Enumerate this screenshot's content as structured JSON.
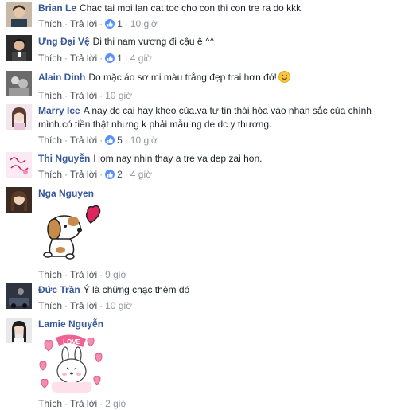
{
  "comments": [
    {
      "author": "Brian Le",
      "text": "Chac tai moi lan cat toc cho con thi con tre ra do kkk",
      "reply": "Thích",
      "reply2": "Trả lời",
      "likes": "1",
      "time": "10 giờ"
    },
    {
      "author": "Ưng Đại Vệ",
      "text": "Đi thi nam vương đi cậu ê ^^",
      "reply": "Thích",
      "reply2": "Trả lời",
      "likes": "1",
      "time": "4 giờ"
    },
    {
      "author": "Alain Dinh",
      "text": "Do mặc áo sơ mi màu trắng đẹp trai hơn đó!",
      "reply": "Thích",
      "reply2": "Trả lời",
      "time": "10 giờ"
    },
    {
      "author": "Marry Ice",
      "text_line1": "A nay dc cai hay kheo của.va tư tin thái hóa vào nhan sắc của chính",
      "text_line2": "mình.có tiền thật nhưng k phải mẫu ng de dc y thương.",
      "reply": "Thích",
      "reply2": "Trả lời",
      "likes": "5",
      "time": "10 giờ"
    },
    {
      "author": "Thi Nguyễn",
      "text": "Hom nay nhin thay a tre va dep zai hon.",
      "reply": "Thích",
      "reply2": "Trả lời",
      "likes": "2",
      "time": "4 giờ"
    },
    {
      "author": "Nga Nguyen",
      "reply": "Thích",
      "reply2": "Trả lời",
      "time": "9 giờ"
    },
    {
      "author": "Đức Trần",
      "text": "Ý là chững chạc thêm đó",
      "reply": "Thích",
      "reply2": "Trả lời",
      "time": "10 giờ"
    },
    {
      "author": "Lamie Nguyễn",
      "reply": "Thích",
      "reply2": "Trả lời",
      "time": "2 giờ",
      "sticker_text": "LOVE"
    }
  ],
  "colors": {
    "author": "#365899",
    "meta": "#90949c",
    "like_badge": "#5890ff",
    "heart": "#e0245e"
  }
}
